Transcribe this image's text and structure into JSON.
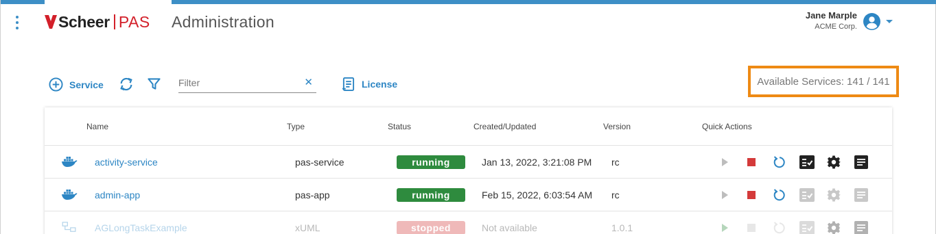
{
  "header": {
    "logo_brand": "Scheer",
    "logo_product": "PAS",
    "app_title": "Administration",
    "user_name": "Jane Marple",
    "user_org": "ACME Corp."
  },
  "toolbar": {
    "service_label": "Service",
    "filter_placeholder": "Filter",
    "filter_clear": "✕",
    "license_label": "License",
    "available_services": "Available Services: 141 / 141"
  },
  "table": {
    "columns": [
      "Name",
      "Type",
      "Status",
      "Created/Updated",
      "Version",
      "Quick Actions"
    ],
    "rows": [
      {
        "name": "activity-service",
        "type": "pas-service",
        "status": "running",
        "updated": "Jan 13, 2022, 3:21:08 PM",
        "version": "rc",
        "icon": "docker-icon"
      },
      {
        "name": "admin-app",
        "type": "pas-app",
        "status": "running",
        "updated": "Feb 15, 2022, 6:03:54 AM",
        "version": "rc",
        "icon": "docker-icon"
      },
      {
        "name": "AGLongTaskExample",
        "type": "xUML",
        "status": "stopped",
        "updated": "Not available",
        "version": "1.0.1",
        "icon": "xuml-diagram-icon"
      }
    ]
  },
  "colors": {
    "accent": "#2d86c4",
    "running": "#2e8b3e",
    "stopped": "#d43a3a",
    "highlight": "#ee8a14",
    "brand_red": "#d3202a"
  }
}
